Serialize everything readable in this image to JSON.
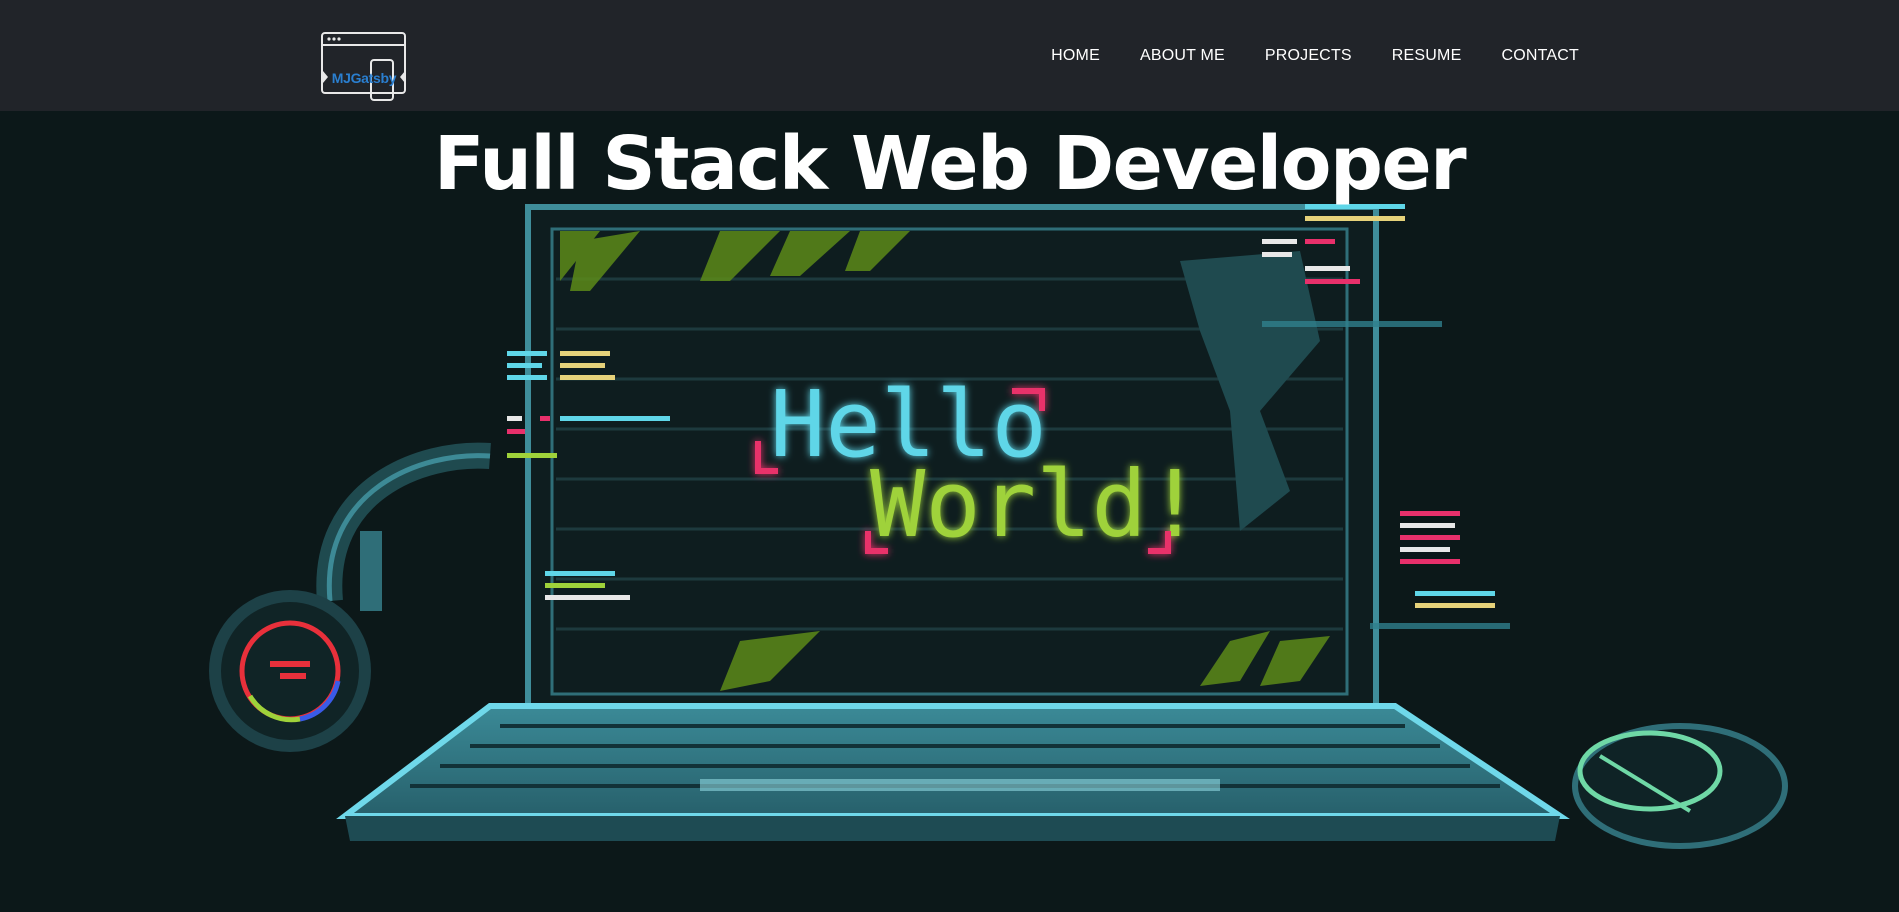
{
  "header": {
    "logo_text": "MJGatsby",
    "nav": [
      {
        "label": "HOME"
      },
      {
        "label": "ABOUT ME"
      },
      {
        "label": "PROJECTS"
      },
      {
        "label": "RESUME"
      },
      {
        "label": "CONTACT"
      }
    ]
  },
  "hero": {
    "title": "Full Stack Web Developer",
    "screen_line1": "Hello",
    "screen_line2": "World!"
  },
  "colors": {
    "navbar_bg": "#212429",
    "hero_bg": "#0c1819",
    "accent_cyan": "#5fd6e8",
    "accent_yellow": "#e6d27a",
    "accent_green": "#9fd23a",
    "accent_pink": "#e8306b"
  },
  "icons": [
    "browser-window-icon",
    "phone-icon",
    "headphones-icon",
    "laptop-icon",
    "mouse-icon"
  ]
}
